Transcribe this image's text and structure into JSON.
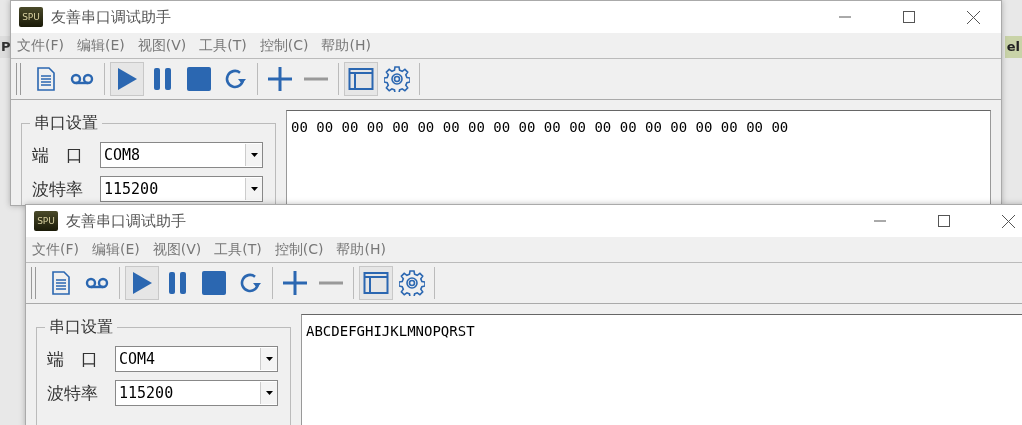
{
  "background_fragments": [
    "P",
    "el"
  ],
  "windows": [
    {
      "title": "友善串口调试助手",
      "logo_text": "SPU",
      "menu": [
        "文件(F)",
        "编辑(E)",
        "视图(V)",
        "工具(T)",
        "控制(C)",
        "帮助(H)"
      ],
      "toolbar": [
        {
          "kind": "document",
          "pressed": false,
          "disabled": false
        },
        {
          "kind": "tape",
          "pressed": false,
          "disabled": false
        },
        {
          "kind": "separator"
        },
        {
          "kind": "play",
          "pressed": true,
          "disabled": false
        },
        {
          "kind": "pause",
          "pressed": false,
          "disabled": false
        },
        {
          "kind": "stop",
          "pressed": false,
          "disabled": false
        },
        {
          "kind": "refresh",
          "pressed": false,
          "disabled": false
        },
        {
          "kind": "separator"
        },
        {
          "kind": "plus",
          "pressed": false,
          "disabled": false
        },
        {
          "kind": "minus",
          "pressed": false,
          "disabled": true
        },
        {
          "kind": "separator"
        },
        {
          "kind": "window",
          "pressed": true,
          "disabled": false
        },
        {
          "kind": "gear",
          "pressed": false,
          "disabled": false
        },
        {
          "kind": "separator"
        }
      ],
      "settings": {
        "title": "串口设置",
        "fields": [
          {
            "label": "端　口",
            "value": "COM8"
          },
          {
            "label": "波特率",
            "value": "115200"
          }
        ]
      },
      "receive_text": "00 00 00 00 00 00 00 00 00 00 00 00 00 00 00 00 00 00 00 00"
    },
    {
      "title": "友善串口调试助手",
      "logo_text": "SPU",
      "menu": [
        "文件(F)",
        "编辑(E)",
        "视图(V)",
        "工具(T)",
        "控制(C)",
        "帮助(H)"
      ],
      "toolbar": [
        {
          "kind": "document",
          "pressed": false,
          "disabled": false
        },
        {
          "kind": "tape",
          "pressed": false,
          "disabled": false
        },
        {
          "kind": "separator"
        },
        {
          "kind": "play",
          "pressed": true,
          "disabled": false
        },
        {
          "kind": "pause",
          "pressed": false,
          "disabled": false
        },
        {
          "kind": "stop",
          "pressed": false,
          "disabled": false
        },
        {
          "kind": "refresh",
          "pressed": false,
          "disabled": false
        },
        {
          "kind": "separator"
        },
        {
          "kind": "plus",
          "pressed": false,
          "disabled": false
        },
        {
          "kind": "minus",
          "pressed": false,
          "disabled": true
        },
        {
          "kind": "separator"
        },
        {
          "kind": "window",
          "pressed": true,
          "disabled": false
        },
        {
          "kind": "gear",
          "pressed": false,
          "disabled": false
        },
        {
          "kind": "separator"
        }
      ],
      "settings": {
        "title": "串口设置",
        "fields": [
          {
            "label": "端　口",
            "value": "COM4"
          },
          {
            "label": "波特率",
            "value": "115200"
          }
        ]
      },
      "receive_text": "ABCDEFGHIJKLMNOPQRST"
    }
  ]
}
